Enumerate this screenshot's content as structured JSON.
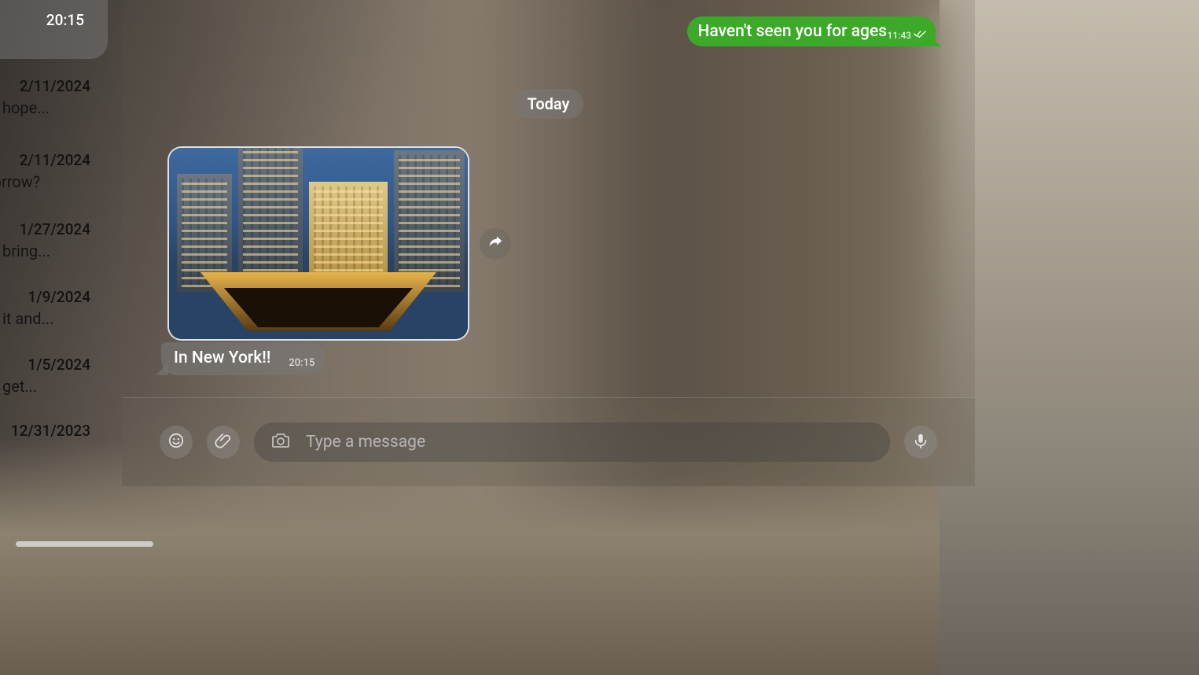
{
  "sidebar": {
    "top_time": "20:15",
    "entries": [
      {
        "date": "2/11/2024",
        "preview": "hope..."
      },
      {
        "date": "2/11/2024",
        "preview": "morrow?"
      },
      {
        "date": "1/27/2024",
        "preview": "bring..."
      },
      {
        "date": "1/9/2024",
        "preview": "it and..."
      },
      {
        "date": "1/5/2024",
        "preview": "get..."
      },
      {
        "date": "12/31/2023",
        "preview": ""
      }
    ]
  },
  "chat": {
    "outgoing": {
      "text": "Haven't seen you for ages",
      "time": "11:43",
      "read": true
    },
    "date_separator": "Today",
    "incoming": {
      "caption": "In New York!!",
      "time": "20:15",
      "image_alt": "New York City skyline at dusk"
    }
  },
  "composer": {
    "placeholder": "Type a message"
  },
  "icons": {
    "share": "share-icon",
    "emoji": "emoji-icon",
    "attach": "paperclip-icon",
    "camera": "camera-icon",
    "mic": "microphone-icon"
  },
  "colors": {
    "outgoing_bubble": "#3da928",
    "incoming_bubble": "rgba(120,120,120,0.6)"
  }
}
